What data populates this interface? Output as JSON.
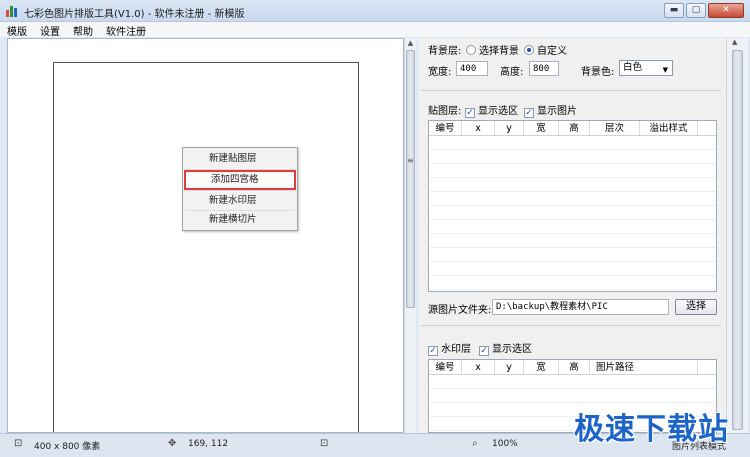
{
  "window": {
    "title": "七彩色图片排版工具(V1.0) - 软件未注册 - 新模版",
    "controls": {
      "minimize": "▬",
      "maximize": "▢",
      "close": "✕"
    }
  },
  "menu": [
    "模版",
    "设置",
    "帮助",
    "软件注册"
  ],
  "context_menu": {
    "items": [
      "新建贴图层",
      "添加四宫格",
      "新建水印层",
      "新建横切片"
    ],
    "highlighted_index": 1
  },
  "background_layer": {
    "label": "背景层:",
    "option_select_bg": "选择背景",
    "option_custom": "自定义",
    "selected": "自定义",
    "width_label": "宽度:",
    "width_value": "400",
    "height_label": "高度:",
    "height_value": "800",
    "bgcolor_label": "背景色:",
    "bgcolor_value": "白色"
  },
  "sticker_layer": {
    "label": "贴图层:",
    "show_selection": "显示选区",
    "show_selection_checked": true,
    "show_image": "显示图片",
    "show_image_checked": true,
    "columns": [
      "编号",
      "x",
      "y",
      "宽",
      "高",
      "层次",
      "溢出样式"
    ],
    "source_folder_label": "源图片文件夹:",
    "source_folder_value": "D:\\backup\\教程素材\\PIC",
    "choose_button": "选择"
  },
  "watermark_layer": {
    "label": "水印层",
    "checked": true,
    "show_selection": "显示选区",
    "show_selection_checked": true,
    "columns": [
      "编号",
      "x",
      "y",
      "宽",
      "高",
      "图片路径"
    ]
  },
  "status": {
    "size": "400 x 800 像素",
    "cursor": "169, 112",
    "zoom": "100%",
    "mode": "图片列表模式"
  },
  "site_watermark": "极速下载站",
  "colors": {
    "accent": "#1f4ea8",
    "highlight_border": "#e33a3a",
    "watermark": "#1c64c8"
  }
}
